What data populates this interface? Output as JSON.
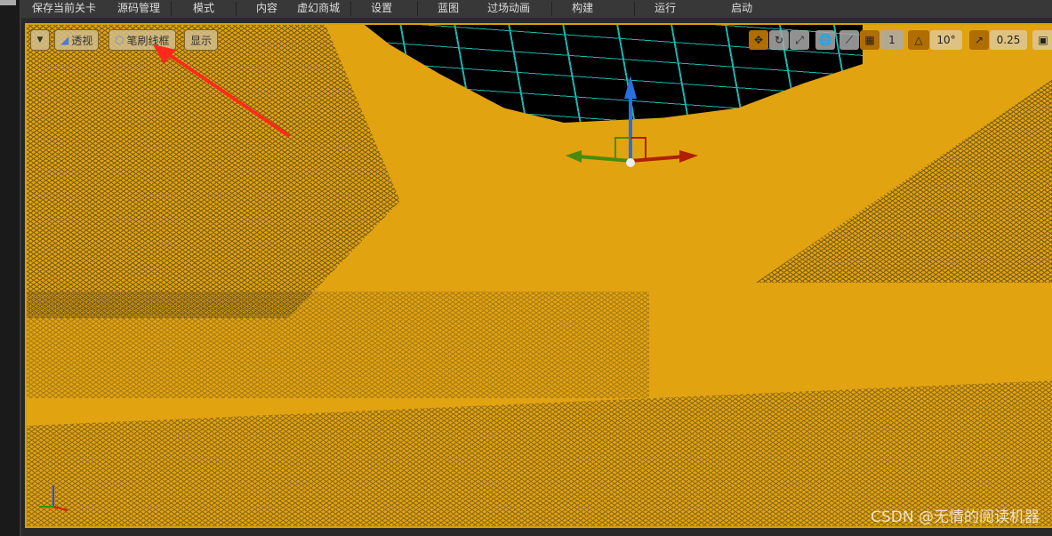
{
  "menu": [
    "保存当前关卡",
    "源码管理",
    "模式",
    "内容",
    "虚幻商城",
    "设置",
    "蓝图",
    "过场动画",
    "构建",
    "运行",
    "启动"
  ],
  "viewport": {
    "perspective_label": "透视",
    "view_mode_label": "笔刷线框",
    "show_label": "显示",
    "grid_snap": "1",
    "rotation_snap": "10°",
    "scale_snap": "0.25"
  },
  "watermark": "CSDN @无情的阅读机器",
  "colors": {
    "terrain": "#e2a310",
    "wire_grid": "#1bb3b0",
    "annotation": "#ff2a1a"
  }
}
